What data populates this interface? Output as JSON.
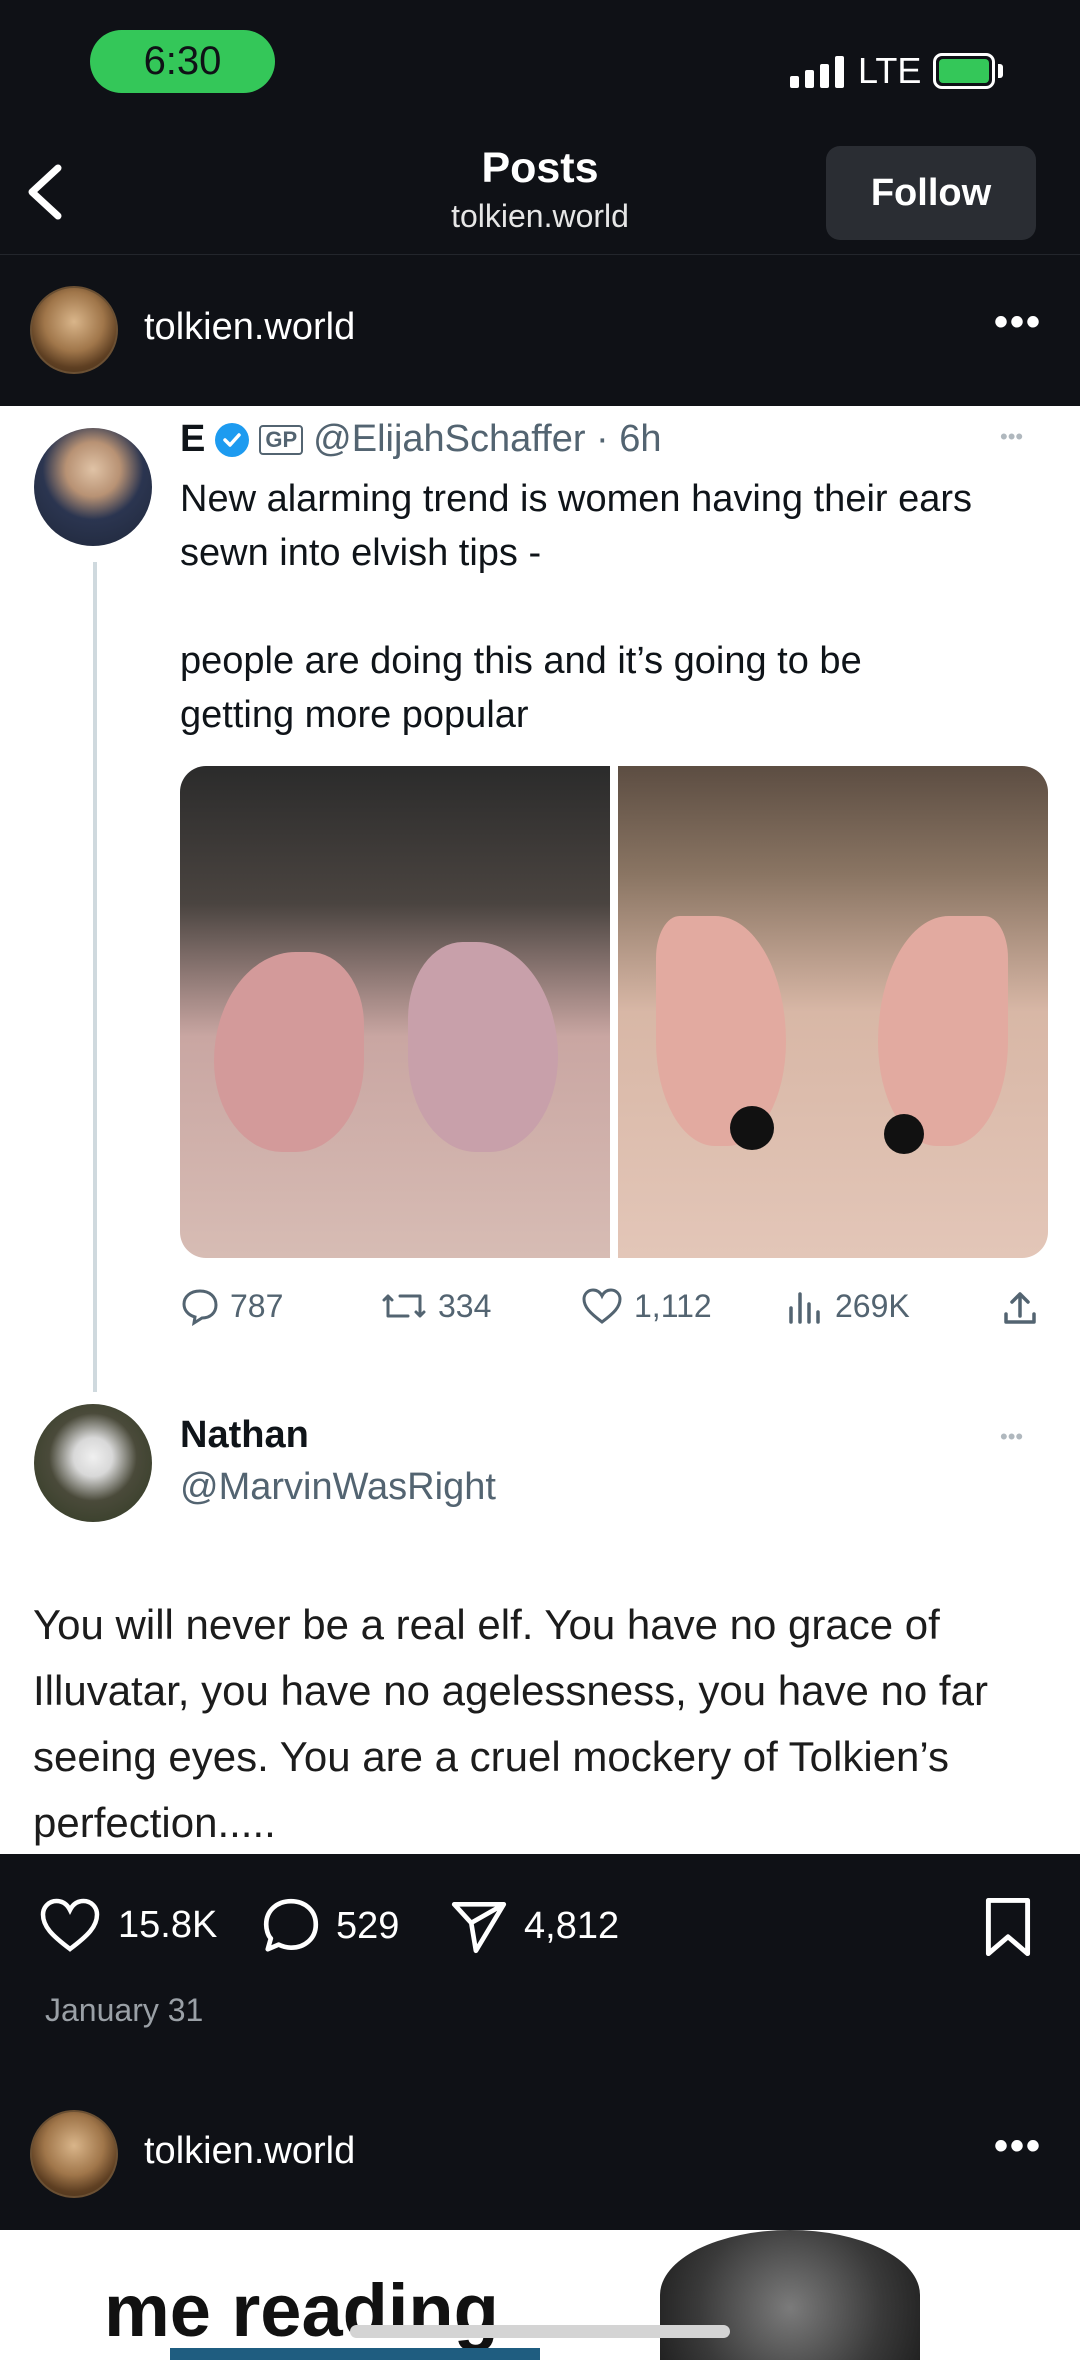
{
  "status": {
    "time": "6:30",
    "network": "LTE"
  },
  "header": {
    "title": "Posts",
    "subtitle": "tolkien.world",
    "follow_label": "Follow"
  },
  "post": {
    "account": "tolkien.world",
    "more": "•••",
    "tweet": {
      "name": "E",
      "badge": "GP",
      "handle_time": "@ElijahSchaffer · 6h",
      "more": "•••",
      "text_line1": "New alarming trend is women having their ears",
      "text_line2": "sewn into elvish tips -",
      "text_line3": "people are doing this and it’s going to be",
      "text_line4": "getting more popular",
      "replies": "787",
      "retweets": "334",
      "likes": "1,112",
      "views": "269K"
    },
    "reply": {
      "name": "Nathan",
      "handle": "@MarvinWasRight",
      "more": "•••",
      "text": "You will never be a real elf. You have no grace of Illuvatar, you have no agelessness, you have no far seeing eyes. You are a cruel mockery of Tolkien’s perfection....."
    },
    "likes": "15.8K",
    "comments": "529",
    "shares": "4,812",
    "date": "January 31"
  },
  "next_post": {
    "account": "tolkien.world",
    "more": "•••",
    "caption_visible": "me reading"
  },
  "colors": {
    "background": "#0f1116",
    "status_pill": "#34c759",
    "verified": "#1d9bf0"
  }
}
